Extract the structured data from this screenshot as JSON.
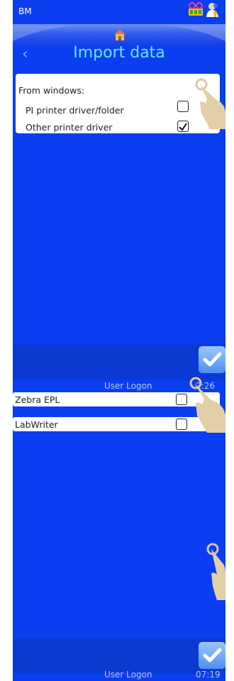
{
  "topbar": {
    "app_id": "BM",
    "printer_icon": "printer-status-icon",
    "person_icon": "user-icon"
  },
  "nav": {
    "home_icon": "home-icon",
    "back_icon": "chevron-left-icon",
    "title": "Import data"
  },
  "import_panel": {
    "heading": "From windows:",
    "options": [
      {
        "label": "PI printer driver/folder",
        "checked": false
      },
      {
        "label": "Other printer driver",
        "checked": true
      }
    ]
  },
  "status_bar_1": {
    "user": "User Logon",
    "time": "2:26"
  },
  "drivers": [
    {
      "label": "Zebra EPL",
      "checked": false
    },
    {
      "label": "LabWriter",
      "checked": false
    }
  ],
  "status_bar_2": {
    "user": "User Logon",
    "time": "07:19"
  },
  "colors": {
    "background": "#0a3ef0",
    "title": "#6fe4ff",
    "accent": "#4d8ff4"
  }
}
